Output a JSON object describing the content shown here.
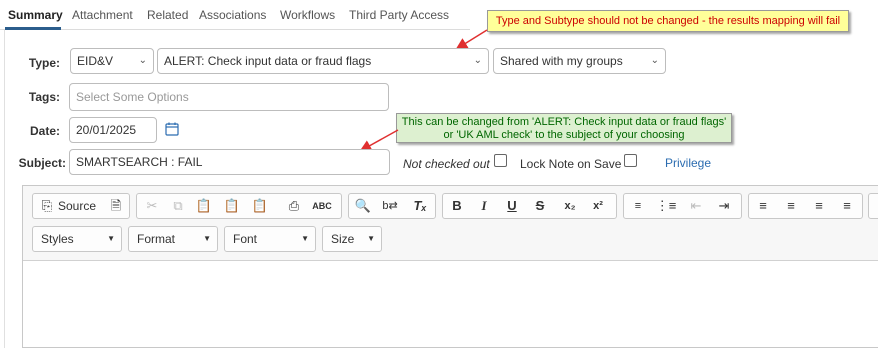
{
  "tabs": [
    {
      "label": "Summary"
    },
    {
      "label": "Attachment"
    },
    {
      "label": "Related"
    },
    {
      "label": "Associations"
    },
    {
      "label": "Workflows"
    },
    {
      "label": "Third Party Access"
    }
  ],
  "form": {
    "type_label": "Type:",
    "type_value": "EID&V",
    "subtype_value": "ALERT: Check input data or fraud flags",
    "sharing_value": "Shared with my groups",
    "tags_label": "Tags:",
    "tags_placeholder": "Select Some Options",
    "date_label": "Date:",
    "date_value": "20/01/2025",
    "subject_label": "Subject:",
    "subject_value": "SMARTSEARCH : FAIL",
    "not_checked_out": "Not checked out",
    "lock_note": "Lock Note on Save",
    "privilege": "Privilege"
  },
  "callouts": {
    "warning": "Type and Subtype should not be changed - the results mapping will fail",
    "info": "This can be changed from 'ALERT: Check input data or fraud flags' or  'UK AML check' to the subject of your choosing"
  },
  "editor": {
    "source_label": "Source",
    "styles": "Styles",
    "format": "Format",
    "font": "Font",
    "size": "Size"
  },
  "colors": {
    "warning_bg": "#ffff99",
    "warning_text": "#cc0000",
    "info_bg": "#ddf0d0",
    "info_text": "#006600",
    "arrow": "#e03030",
    "link": "#2b6cb0",
    "tab_underline": "#2b5d8c"
  }
}
